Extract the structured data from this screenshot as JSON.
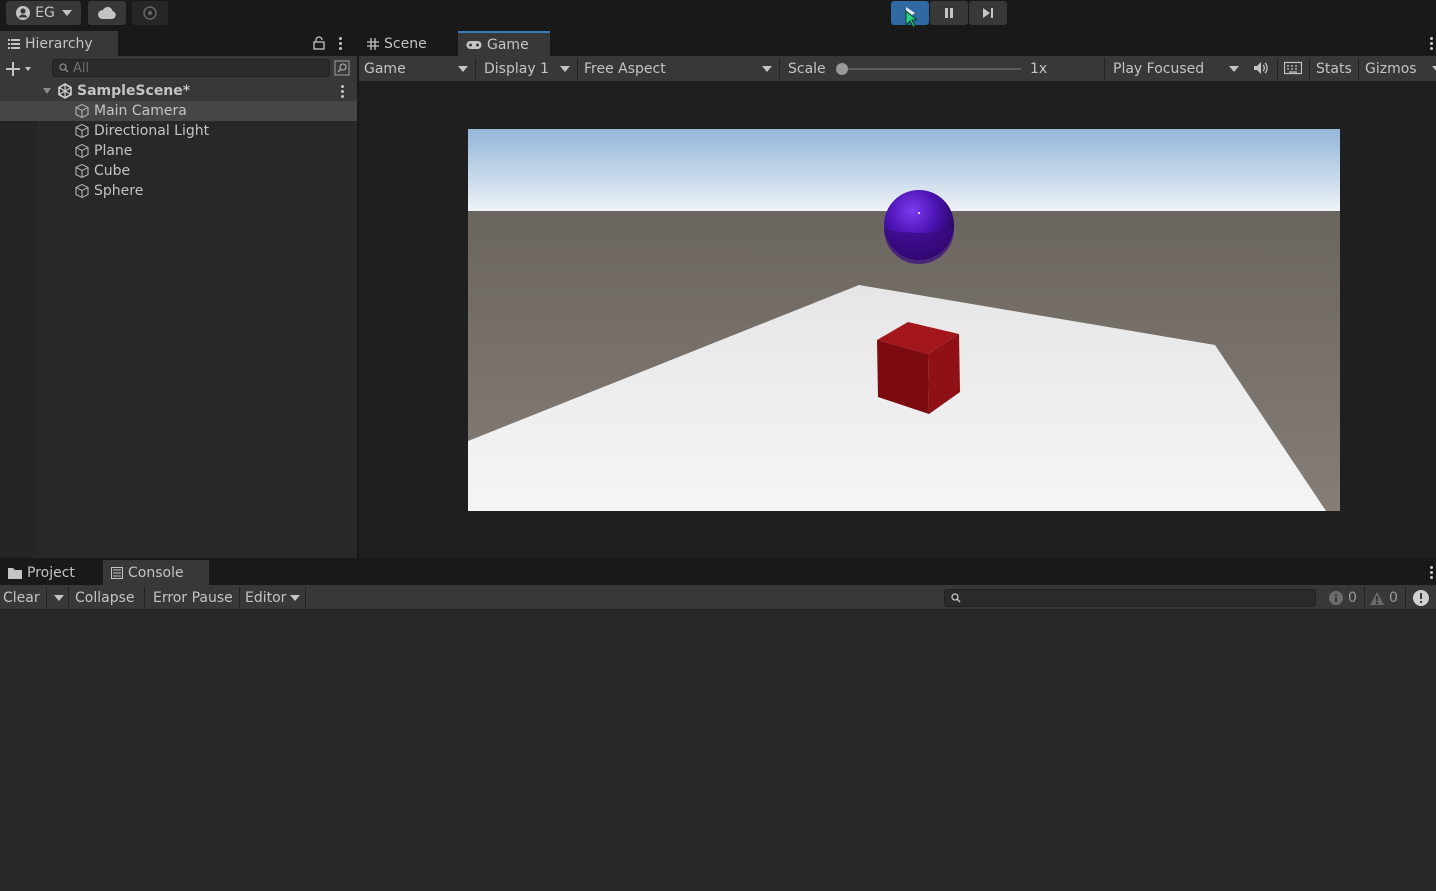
{
  "topbar": {
    "account_label": "EG",
    "controls": [
      "play",
      "pause",
      "step"
    ]
  },
  "hierarchy": {
    "tab_label": "Hierarchy",
    "search_placeholder": "All",
    "scene_name": "SampleScene*",
    "items": [
      {
        "label": "Main Camera",
        "selected": true
      },
      {
        "label": "Directional Light",
        "selected": false
      },
      {
        "label": "Plane",
        "selected": false
      },
      {
        "label": "Cube",
        "selected": false
      },
      {
        "label": "Sphere",
        "selected": false
      }
    ]
  },
  "view": {
    "tabs": [
      {
        "label": "Scene",
        "icon": "grid-icon",
        "active": false
      },
      {
        "label": "Game",
        "icon": "gamepad-icon",
        "active": true
      }
    ],
    "toolbar": {
      "view_mode": "Game",
      "display": "Display 1",
      "aspect": "Free Aspect",
      "scale_label": "Scale",
      "scale_value": "1x",
      "play_mode": "Play Focused",
      "stats_label": "Stats",
      "gizmos_label": "Gizmos"
    }
  },
  "console": {
    "tabs": [
      {
        "label": "Project",
        "icon": "folder-icon",
        "active": false
      },
      {
        "label": "Console",
        "icon": "console-icon",
        "active": true
      }
    ],
    "toolbar": {
      "clear_label": "Clear",
      "collapse_label": "Collapse",
      "error_pause_label": "Error Pause",
      "editor_label": "Editor",
      "info_count": "0",
      "warning_count": "0"
    }
  },
  "colors": {
    "play_active": "#2f6aa3",
    "panel_bg": "#282828",
    "toolbar_bg": "#383838",
    "selection": "#464646",
    "sphere": "#5b1fb8",
    "cube": "#8b0f12",
    "plane": "#f0f0f0",
    "ground": "#7d7670"
  }
}
